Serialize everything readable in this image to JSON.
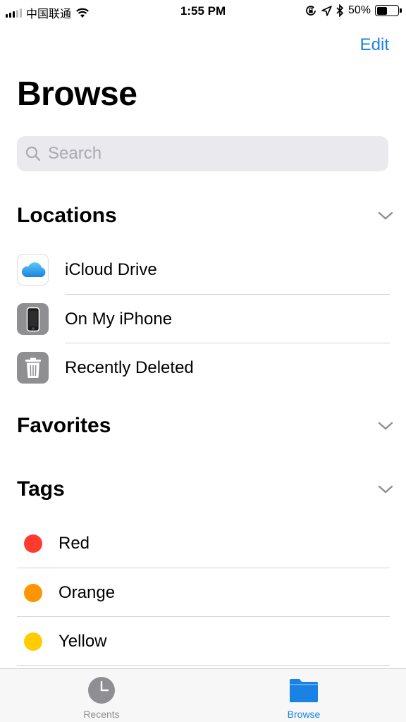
{
  "status_bar": {
    "carrier": "中国联通",
    "time": "1:55 PM",
    "battery_percent": "50%",
    "battery_level": 0.5,
    "signal_bars_active": 3,
    "signal_bars_total": 5
  },
  "header": {
    "edit_label": "Edit",
    "title": "Browse"
  },
  "search": {
    "placeholder": "Search",
    "value": ""
  },
  "sections": {
    "locations": {
      "title": "Locations",
      "items": [
        {
          "label": "iCloud Drive",
          "icon": "icloud-icon"
        },
        {
          "label": "On My iPhone",
          "icon": "iphone-icon"
        },
        {
          "label": "Recently Deleted",
          "icon": "trash-icon"
        }
      ]
    },
    "favorites": {
      "title": "Favorites"
    },
    "tags": {
      "title": "Tags",
      "items": [
        {
          "label": "Red",
          "color": "#ff3b30"
        },
        {
          "label": "Orange",
          "color": "#ff9500"
        },
        {
          "label": "Yellow",
          "color": "#ffcc00"
        }
      ]
    }
  },
  "tab_bar": {
    "tabs": [
      {
        "label": "Recents",
        "icon": "clock-icon",
        "active": false
      },
      {
        "label": "Browse",
        "icon": "folder-icon",
        "active": true
      }
    ]
  },
  "colors": {
    "accent": "#1a82e2",
    "inactive": "#8e8e93"
  }
}
